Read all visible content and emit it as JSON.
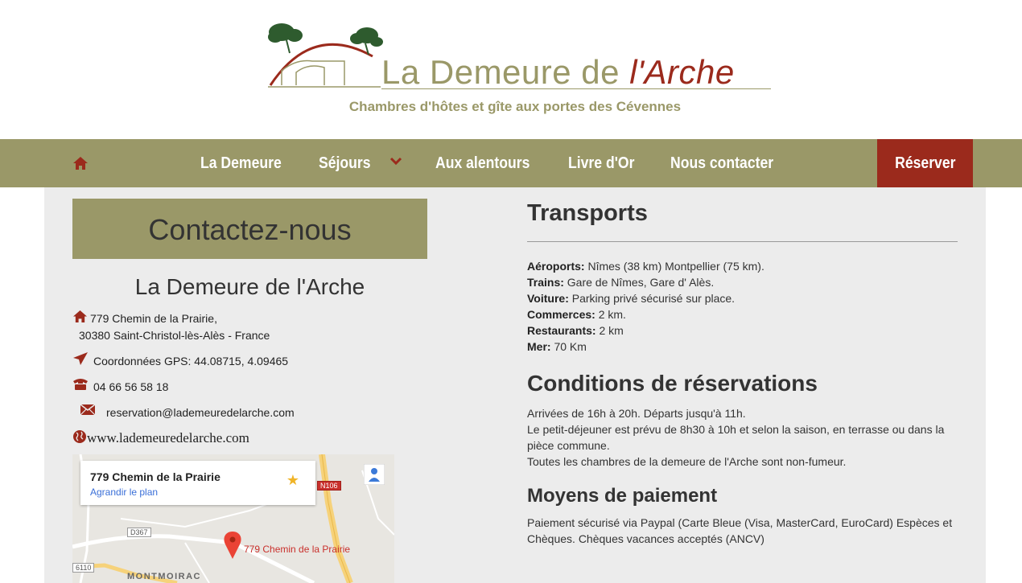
{
  "header": {
    "logo_title_main": "La Demeure de ",
    "logo_title_accent": "l'Arche",
    "tagline": "Chambres d'hôtes et gîte aux portes des Cévennes"
  },
  "nav": {
    "items": [
      "La Demeure",
      "Séjours",
      "Aux alentours",
      "Livre d'Or",
      "Nous contacter"
    ],
    "reserve": "Réserver"
  },
  "contact": {
    "heading": "Contactez-nous",
    "name": "La Demeure de l'Arche",
    "address_line1": "779 Chemin de la Prairie,",
    "address_line2": "30380 Saint-Christol-lès-Alès - France",
    "gps": "Coordonnées GPS: 44.08715, 4.09465",
    "phone": "04 66 56 58 18",
    "email": "reservation@lademeuredelarche.com",
    "website": "www.lademeuredelarche.com"
  },
  "map": {
    "card_title": "779 Chemin de la Prairie",
    "card_link": "Agrandir le plan",
    "pin_label": "779 Chemin de la Prairie",
    "road_n106": "N106",
    "road_d367": "D367",
    "road_6110": "6110",
    "town": "MONTMOIRAC"
  },
  "transports": {
    "heading": "Transports",
    "rows": [
      {
        "label": "Aéroports:",
        "value": " Nîmes (38 km) Montpellier (75 km)."
      },
      {
        "label": "Trains:",
        "value": " Gare de Nîmes, Gare d' Alès."
      },
      {
        "label": "Voiture:",
        "value": " Parking privé sécurisé sur place."
      },
      {
        "label": "Commerces:",
        "value": " 2 km."
      },
      {
        "label": "Restaurants:",
        "value": " 2 km"
      },
      {
        "label": "Mer:",
        "value": " 70 Km"
      }
    ]
  },
  "conditions": {
    "heading": "Conditions de réservations",
    "p1": "Arrivées de 16h à 20h. Départs jusqu'à 11h.",
    "p2": "Le petit-déjeuner est prévu de 8h30 à 10h et selon la saison, en terrasse ou dans la pièce commune.",
    "p3": "Toutes les chambres de la demeure de l'Arche sont non-fumeur."
  },
  "payment": {
    "heading": "Moyens de paiement",
    "text": "Paiement sécurisé via Paypal (Carte Bleue (Visa, MasterCard, EuroCard) Espèces et Chèques. Chèques vacances acceptés (ANCV)"
  },
  "colors": {
    "olive": "#9a9868",
    "red": "#9b2a1c",
    "content_bg": "#ececec"
  }
}
